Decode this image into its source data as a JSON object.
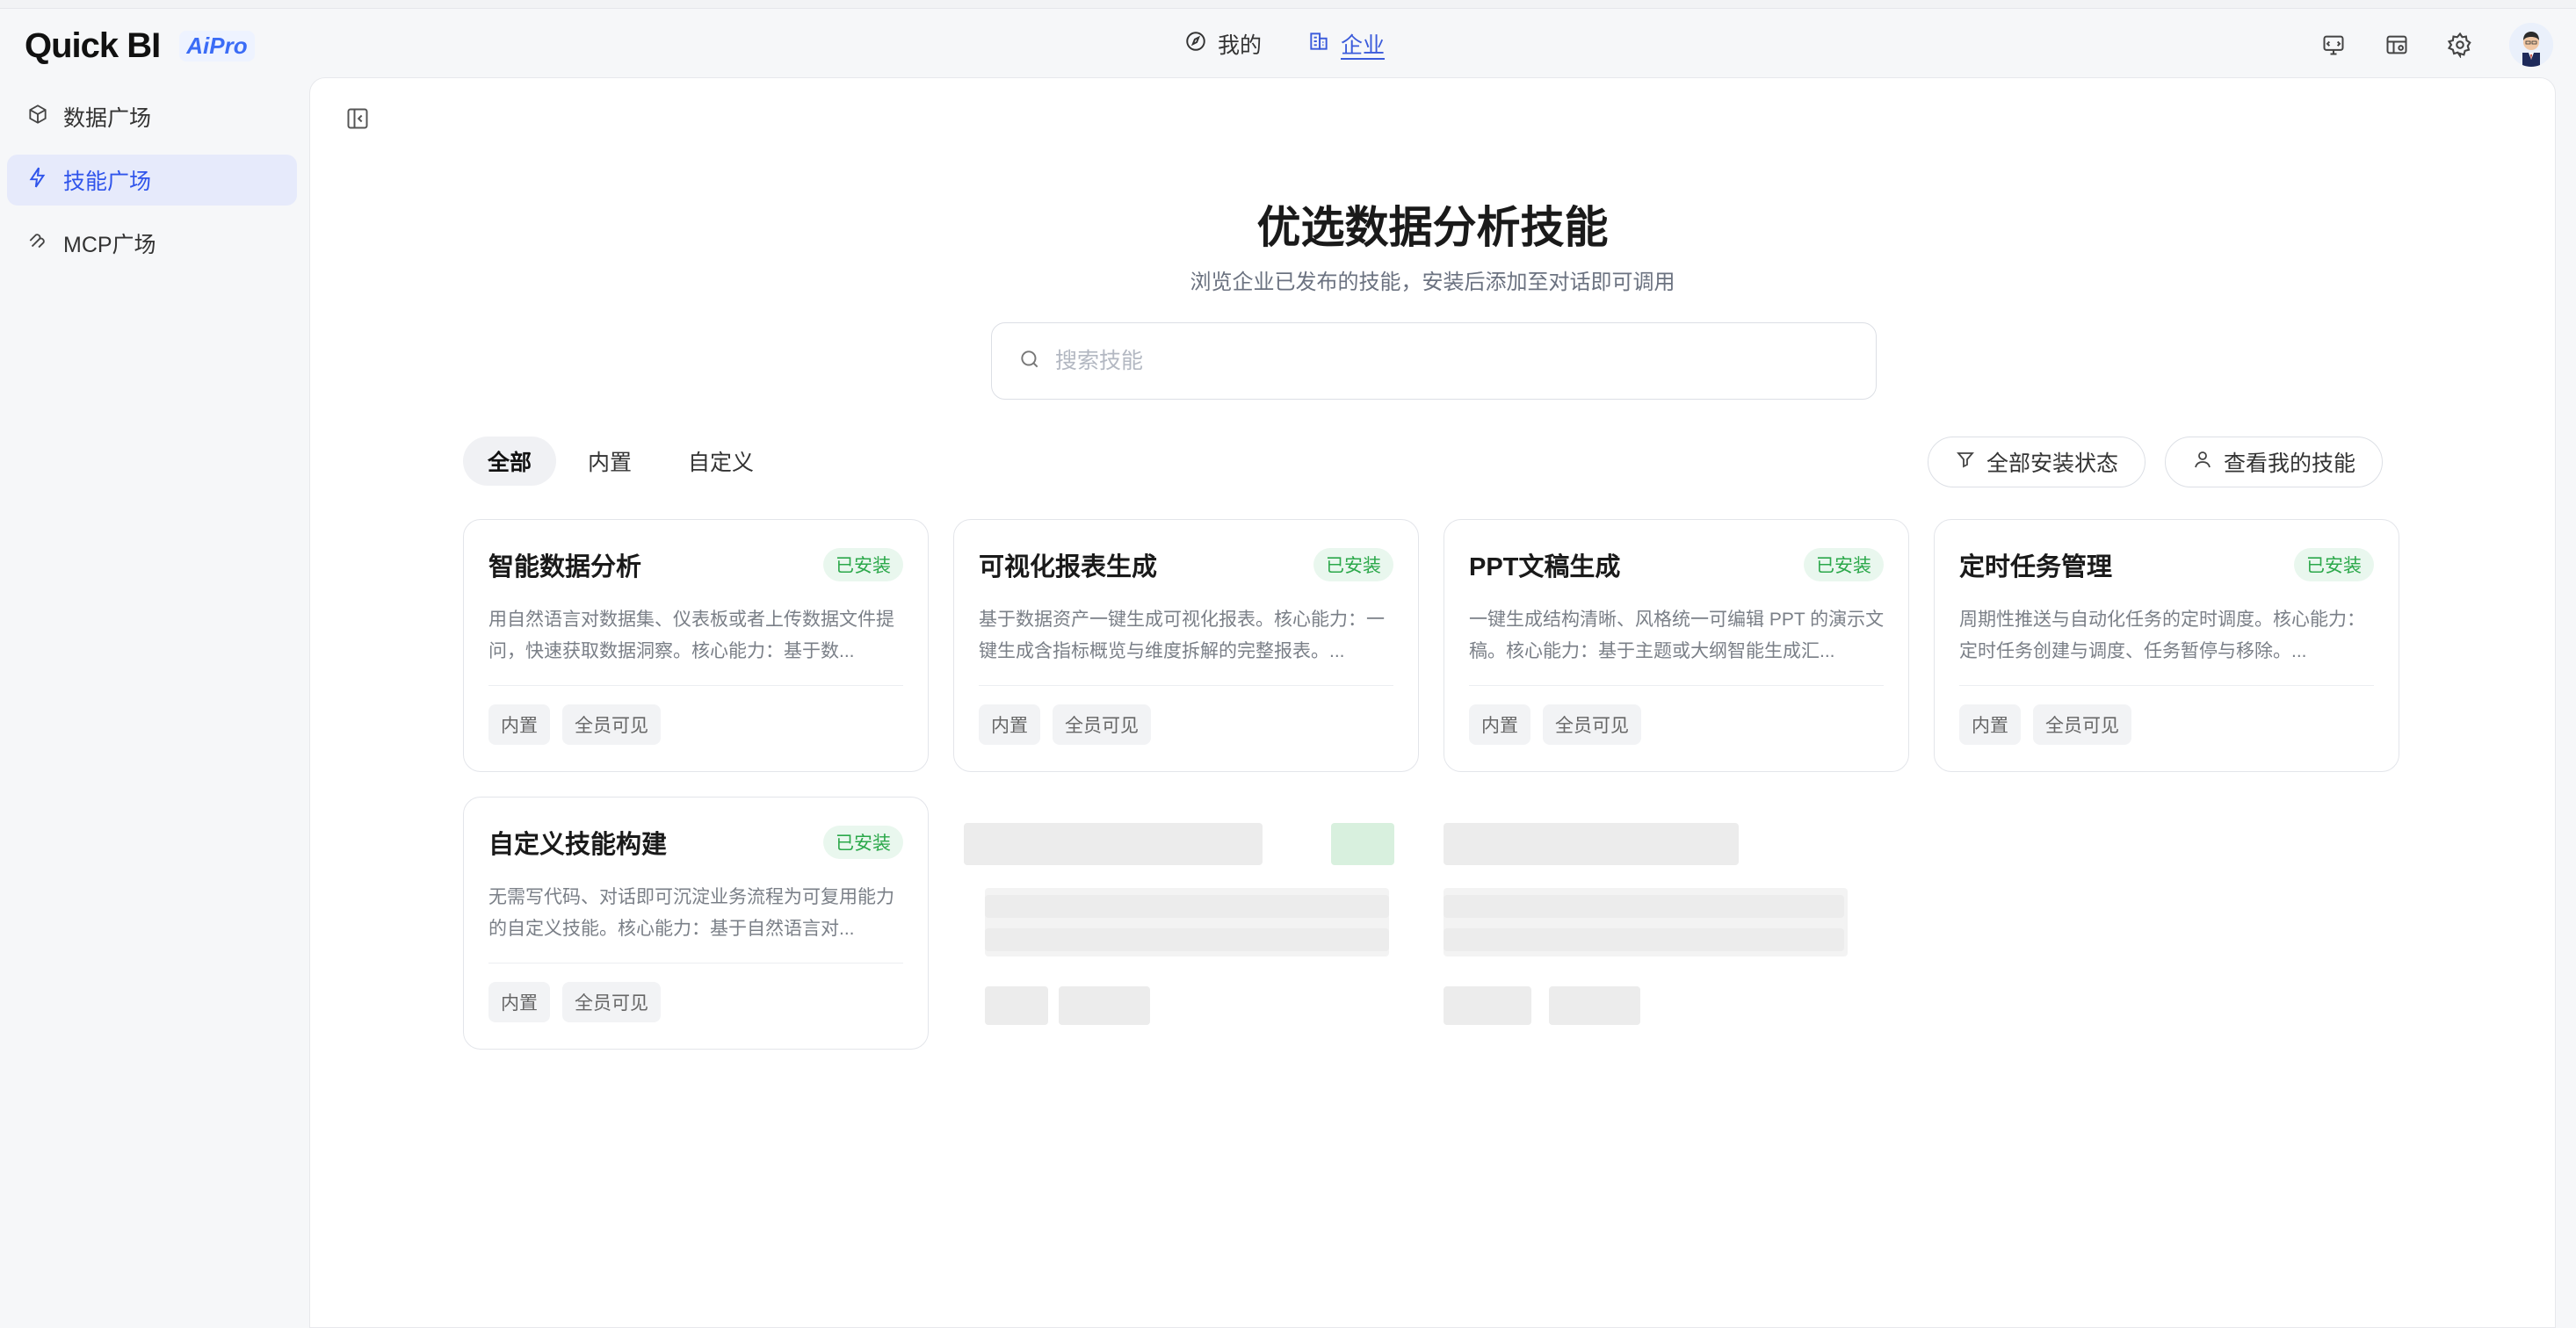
{
  "header": {
    "logo_text": "Quick BI",
    "logo_badge": "AiPro",
    "nav": [
      {
        "label": "我的",
        "icon": "compass-icon"
      },
      {
        "label": "企业",
        "icon": "building-icon"
      }
    ],
    "right_icons": [
      "monitor-icon",
      "dashboard-icon",
      "gear-icon",
      "avatar"
    ]
  },
  "sidebar": {
    "items": [
      {
        "label": "数据广场",
        "icon": "cube-icon"
      },
      {
        "label": "技能广场",
        "icon": "lightning-icon",
        "active": true
      },
      {
        "label": "MCP广场",
        "icon": "mcp-icon"
      }
    ]
  },
  "main": {
    "title": "优选数据分析技能",
    "subtitle": "浏览企业已发布的技能，安装后添加至对话即可调用",
    "search": {
      "placeholder": "搜索技能",
      "value": ""
    },
    "tabs": [
      {
        "label": "全部",
        "active": true
      },
      {
        "label": "内置"
      },
      {
        "label": "自定义"
      }
    ],
    "filter_button": "全部安装状态",
    "my_skills_button": "查看我的技能",
    "cards": [
      {
        "title": "智能数据分析",
        "status": "已安装",
        "desc": "用自然语言对数据集、仪表板或者上传数据文件提问，快速获取数据洞察。核心能力：基于数...",
        "tags": [
          "内置",
          "全员可见"
        ]
      },
      {
        "title": "可视化报表生成",
        "status": "已安装",
        "desc": "基于数据资产一键生成可视化报表。核心能力：一键生成含指标概览与维度拆解的完整报表。...",
        "tags": [
          "内置",
          "全员可见"
        ]
      },
      {
        "title": "PPT文稿生成",
        "status": "已安装",
        "desc": "一键生成结构清晰、风格统一可编辑 PPT 的演示文稿。核心能力：基于主题或大纲智能生成汇...",
        "tags": [
          "内置",
          "全员可见"
        ]
      },
      {
        "title": "定时任务管理",
        "status": "已安装",
        "desc": "周期性推送与自动化任务的定时调度。核心能力：定时任务创建与调度、任务暂停与移除。...",
        "tags": [
          "内置",
          "全员可见"
        ]
      },
      {
        "title": "自定义技能构建",
        "status": "已安装",
        "desc": "无需写代码、对话即可沉淀业务流程为可复用能力的自定义技能。核心能力：基于自然语言对...",
        "tags": [
          "内置",
          "全员可见"
        ]
      }
    ]
  },
  "colors": {
    "accent": "#2f54eb",
    "installed_badge_bg": "#e9f7ee",
    "installed_badge_text": "#2ba84a"
  }
}
